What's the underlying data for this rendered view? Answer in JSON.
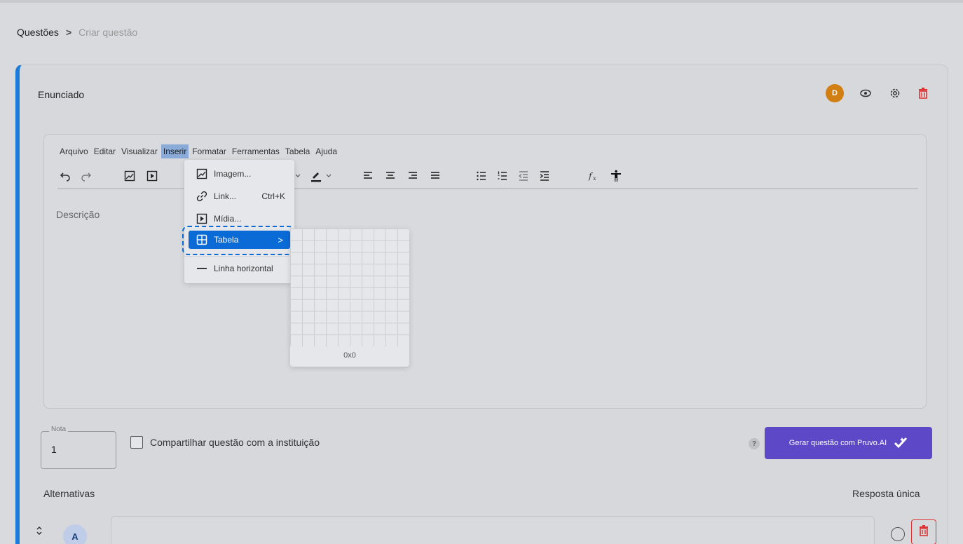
{
  "breadcrumb": {
    "parent": "Questões",
    "separator": ">",
    "current": "Criar questão"
  },
  "statement": {
    "title": "Enunciado",
    "avatar_letter": "D"
  },
  "editor": {
    "menu": [
      "Arquivo",
      "Editar",
      "Visualizar",
      "Inserir",
      "Formatar",
      "Ferramentas",
      "Tabela",
      "Ajuda"
    ],
    "placeholder": "Descrição"
  },
  "insert_menu": {
    "items": [
      {
        "label": "Imagem...",
        "shortcut": "",
        "icon": "image-icon"
      },
      {
        "label": "Link...",
        "shortcut": "Ctrl+K",
        "icon": "link-icon"
      },
      {
        "label": "Mídia...",
        "shortcut": "",
        "icon": "media-icon"
      },
      {
        "label": "Tabela",
        "shortcut": ">",
        "icon": "table-icon"
      },
      {
        "label": "Linha horizontal",
        "shortcut": "",
        "icon": "horizontal-line-icon"
      }
    ]
  },
  "table_picker": {
    "size_label": "0x0"
  },
  "nota": {
    "legend": "Nota",
    "value": "1"
  },
  "share": {
    "label": "Compartilhar questão com a instituição"
  },
  "help": {
    "glyph": "?"
  },
  "generate": {
    "label": "Gerar questão com Pruvo.AI"
  },
  "alternatives": {
    "title": "Alternativas",
    "answer_mode": "Resposta única",
    "first_letter": "A"
  },
  "colors": {
    "accent": "#1a7bd8",
    "highlight": "#0b6bd6",
    "ai_button": "#5d48c8",
    "danger": "#d33333",
    "avatar": "#d17f12"
  }
}
